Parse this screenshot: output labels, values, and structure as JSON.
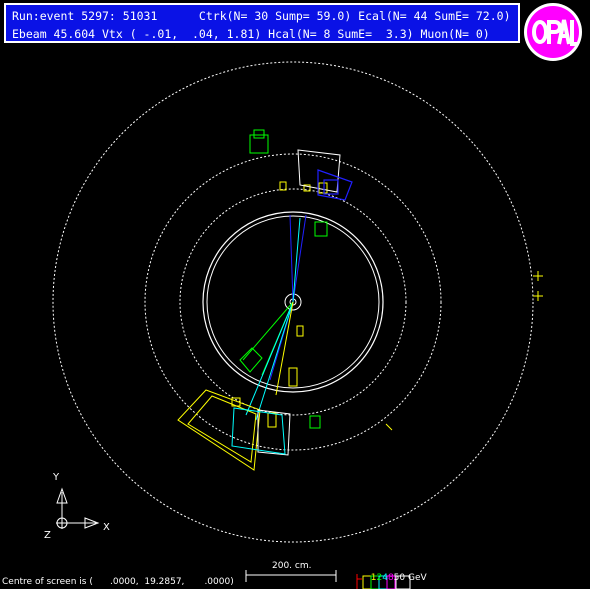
{
  "header": {
    "line1": "Run:event 5297: 51031      Ctrk(N= 30 Sump= 59.0) Ecal(N= 44 SumE= 72.0)",
    "line2": "Ebeam 45.604 Vtx ( -.01,  .04, 1.81) Hcal(N= 8 SumE=  3.3) Muon(N= 0)"
  },
  "logo": {
    "text": "OPAL"
  },
  "axes": {
    "y": "Y",
    "x": "X",
    "z": "Z"
  },
  "scale": {
    "label": "200. cm."
  },
  "energy_legend": {
    "items": [
      {
        "text": "1",
        "color": "#ffff00"
      },
      {
        "text": "2",
        "color": "#00ff00"
      },
      {
        "text": "4",
        "color": "#00ffff"
      },
      {
        "text": "8",
        "color": "#ff00ff"
      },
      {
        "text": "50 GeV",
        "color": "#ffffff"
      }
    ]
  },
  "footer": {
    "centre": "Centre of screen is (      .0000,  19.2857,       .0000)"
  },
  "colors": {
    "header_bg": "#0a12e6",
    "track_blue": "#2020ff",
    "ecal_yellow": "#ffff00",
    "hcal_green": "#00ff00",
    "cyan": "#00ffff"
  }
}
